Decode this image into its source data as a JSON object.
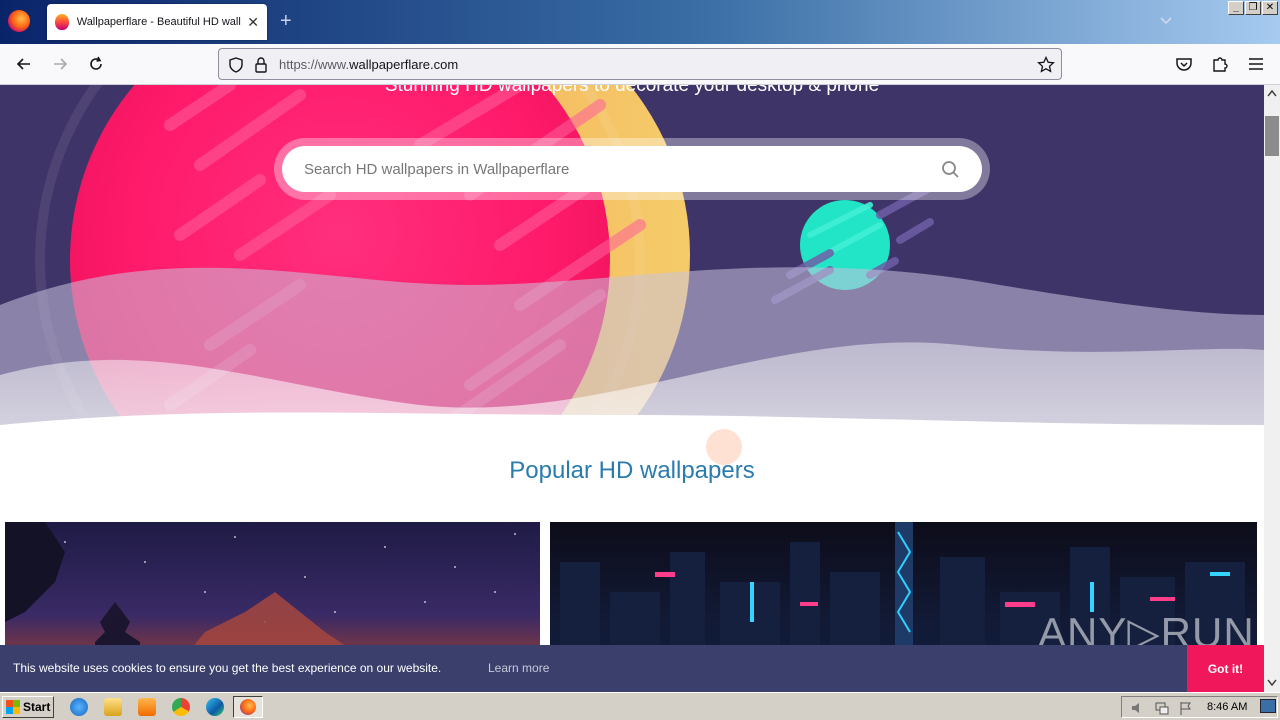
{
  "browser": {
    "tab_title": "Wallpaperflare - Beautiful HD wallpapers",
    "url_prefix": "https://www.",
    "url_domain": "wallpaperflare.com",
    "new_tab_label": "+",
    "tab_close": "✕",
    "window_controls": [
      "_",
      "❐",
      "✕"
    ]
  },
  "hero": {
    "tagline": "Stunning HD wallpapers to decorate your desktop & phone",
    "search_placeholder": "Search HD wallpapers in Wallpaperflare"
  },
  "section": {
    "popular_title": "Popular HD wallpapers"
  },
  "cookie": {
    "message": "This website uses cookies to ensure you get the best experience on our website.",
    "learn_more": "Learn more",
    "button": "Got it!"
  },
  "watermark": "ANY▷RUN",
  "taskbar": {
    "start_label": "Start",
    "clock": "8:46 AM"
  },
  "colors": {
    "hero_bg": "#3f3468",
    "accent_pink": "#f1175b",
    "title_blue": "#2a7bae",
    "cookie_bg": "#3a3f6b"
  }
}
